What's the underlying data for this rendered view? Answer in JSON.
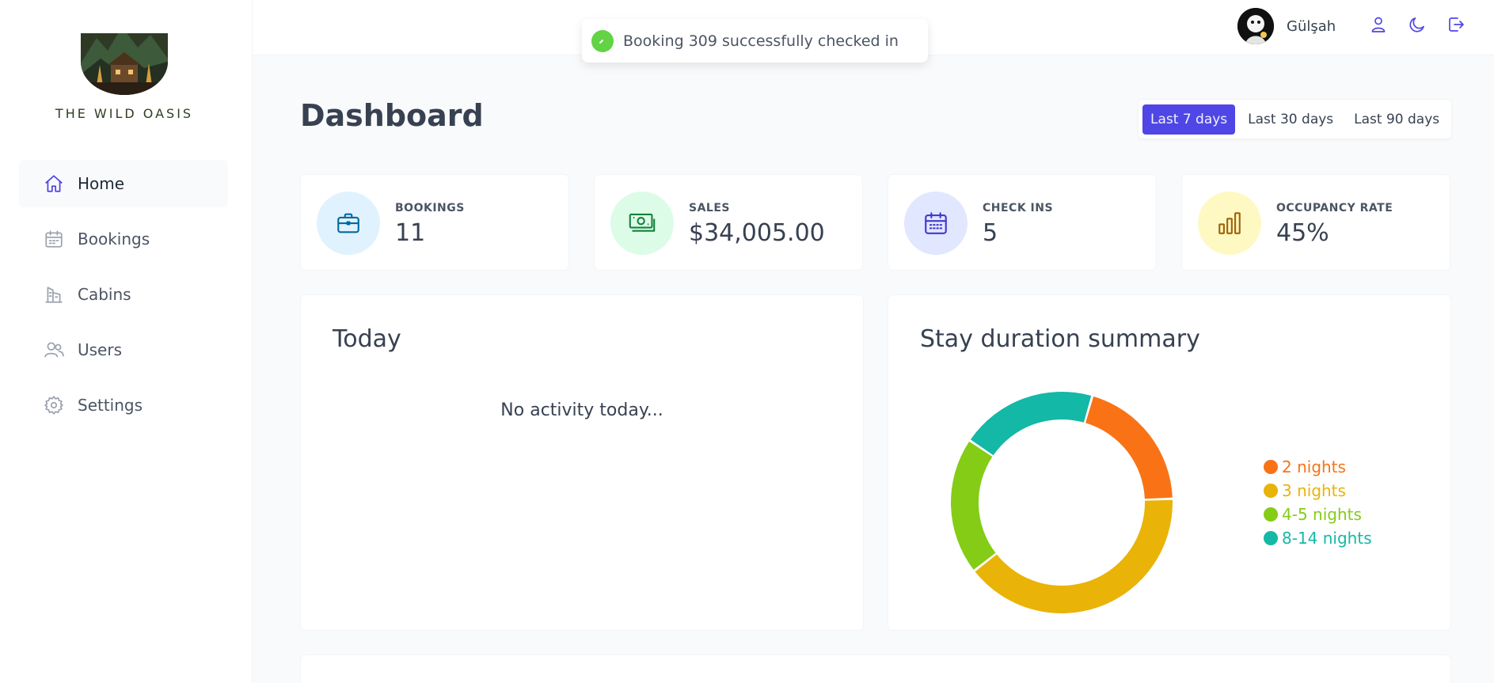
{
  "app": {
    "logo_text": "THE WILD OASIS"
  },
  "sidebar": {
    "items": [
      {
        "label": "Home",
        "icon": "home-icon",
        "active": true
      },
      {
        "label": "Bookings",
        "icon": "calendar-icon",
        "active": false
      },
      {
        "label": "Cabins",
        "icon": "building-icon",
        "active": false
      },
      {
        "label": "Users",
        "icon": "users-icon",
        "active": false
      },
      {
        "label": "Settings",
        "icon": "gear-icon",
        "active": false
      }
    ]
  },
  "header": {
    "user_name": "Gülşah",
    "icons": [
      "user-icon",
      "moon-icon",
      "logout-icon"
    ]
  },
  "toast": {
    "message": "Booking 309 successfully checked in",
    "icon": "spinner-icon",
    "color": "#61d345"
  },
  "main": {
    "title": "Dashboard",
    "filters": [
      {
        "label": "Last 7 days",
        "active": true
      },
      {
        "label": "Last 30 days",
        "active": false
      },
      {
        "label": "Last 90 days",
        "active": false
      }
    ],
    "stats": [
      {
        "label": "BOOKINGS",
        "value": "11",
        "icon": "briefcase-icon",
        "color": "#0369a1",
        "bg": "#e0f2fe"
      },
      {
        "label": "SALES",
        "value": "$34,005.00",
        "icon": "banknotes-icon",
        "color": "#15803d",
        "bg": "#dcfce7"
      },
      {
        "label": "CHECK INS",
        "value": "5",
        "icon": "calendar-days-icon",
        "color": "#4338ca",
        "bg": "#e0e7ff"
      },
      {
        "label": "OCCUPANCY RATE",
        "value": "45%",
        "icon": "chart-bar-icon",
        "color": "#a16207",
        "bg": "#fef9c3"
      }
    ],
    "today": {
      "title": "Today",
      "empty_text": "No activity today..."
    },
    "stay_summary": {
      "title": "Stay duration summary"
    }
  },
  "chart_data": {
    "type": "pie",
    "title": "Stay duration summary",
    "categories": [
      "2 nights",
      "3 nights",
      "4-5 nights",
      "8-14 nights"
    ],
    "values": [
      2,
      4,
      2,
      2
    ],
    "colors": [
      "#f97316",
      "#eab308",
      "#84cc16",
      "#14b8a6"
    ],
    "legend": "right"
  }
}
